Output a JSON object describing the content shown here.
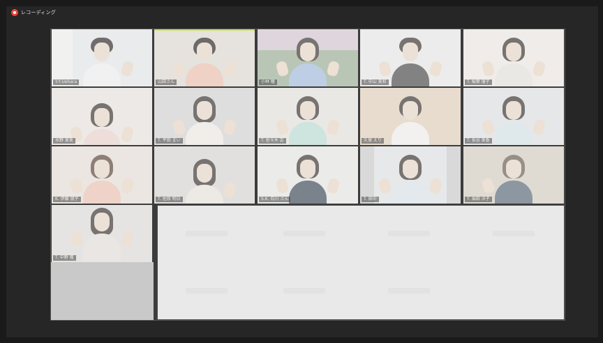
{
  "recording": {
    "label": "レコーディング"
  },
  "participants": [
    {
      "name": "Y.Y-Uehara"
    },
    {
      "name": "山田さん"
    },
    {
      "name": "小林 瞳"
    },
    {
      "name": "T. 中山 美和"
    },
    {
      "name": "T. 稲葉 瑠子"
    },
    {
      "name": "水野 恵美"
    },
    {
      "name": "T. 平田 まい"
    },
    {
      "name": "T. 佐々木 志"
    },
    {
      "name": "久保 えり"
    },
    {
      "name": "T. 長谷 美香"
    },
    {
      "name": "K. 伊藤 朋子"
    },
    {
      "name": "T. 佐原 明日"
    },
    {
      "name": "S.K. 石川 さん"
    },
    {
      "name": "T. 田中"
    },
    {
      "name": "T. 福田 洋子"
    },
    {
      "name": "T. 中野 隆"
    }
  ]
}
